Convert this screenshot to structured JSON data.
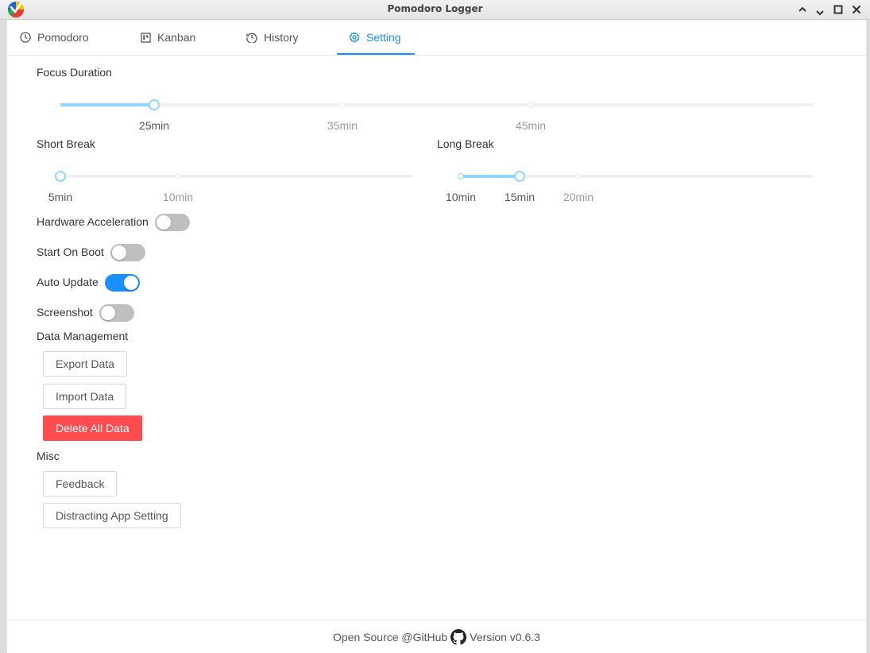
{
  "window": {
    "title": "Pomodoro Logger"
  },
  "tabs": [
    {
      "label": "Pomodoro",
      "icon": "clock-icon"
    },
    {
      "label": "Kanban",
      "icon": "kanban-icon"
    },
    {
      "label": "History",
      "icon": "history-icon"
    },
    {
      "label": "Setting",
      "icon": "gear-icon",
      "active": true
    }
  ],
  "settings": {
    "focus_duration": {
      "label": "Focus Duration",
      "value": "25min",
      "marks": [
        "25min",
        "35min",
        "45min"
      ]
    },
    "short_break": {
      "label": "Short Break",
      "value": "5min",
      "marks": [
        "5min",
        "10min"
      ]
    },
    "long_break": {
      "label": "Long Break",
      "value": "15min",
      "marks": [
        "10min",
        "15min",
        "20min"
      ]
    },
    "hardware_acceleration": {
      "label": "Hardware Acceleration",
      "on": false
    },
    "start_on_boot": {
      "label": "Start On Boot",
      "on": false
    },
    "auto_update": {
      "label": "Auto Update",
      "on": true
    },
    "screenshot": {
      "label": "Screenshot",
      "on": false
    }
  },
  "data_management": {
    "heading": "Data Management",
    "export_label": "Export Data",
    "import_label": "Import Data",
    "delete_label": "Delete All Data"
  },
  "misc": {
    "heading": "Misc",
    "feedback_label": "Feedback",
    "distracting_label": "Distracting App Setting"
  },
  "footer": {
    "open_source": "Open Source @GitHub",
    "version": "Version v0.6.3"
  },
  "colors": {
    "accent": "#1890ff",
    "slider_track": "#91d5ff",
    "danger": "#ff4d4f",
    "switch_off": "#bfbfbf"
  }
}
